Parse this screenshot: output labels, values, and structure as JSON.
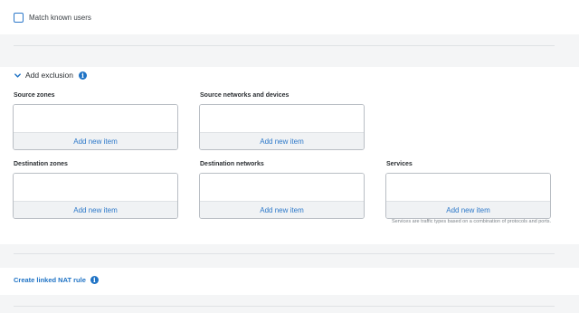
{
  "match_known_users": {
    "label": "Match known users",
    "checked": false
  },
  "exclusion": {
    "title": "Add exclusion",
    "expanded": true,
    "fields": {
      "source_zones": {
        "label": "Source zones",
        "add_label": "Add new item"
      },
      "source_networks": {
        "label": "Source networks and devices",
        "add_label": "Add new item"
      },
      "destination_zones": {
        "label": "Destination zones",
        "add_label": "Add new item"
      },
      "destination_networks": {
        "label": "Destination networks",
        "add_label": "Add new item"
      },
      "services": {
        "label": "Services",
        "add_label": "Add new item",
        "hint": "Services are traffic types based on a combination of protocols and ports."
      }
    }
  },
  "nat": {
    "link_label": "Create linked NAT rule"
  },
  "colors": {
    "accent": "#2c78c9",
    "info": "#1f73c5",
    "background": "#f4f5f6",
    "panel": "#ffffff",
    "border": "#b9bec4"
  }
}
